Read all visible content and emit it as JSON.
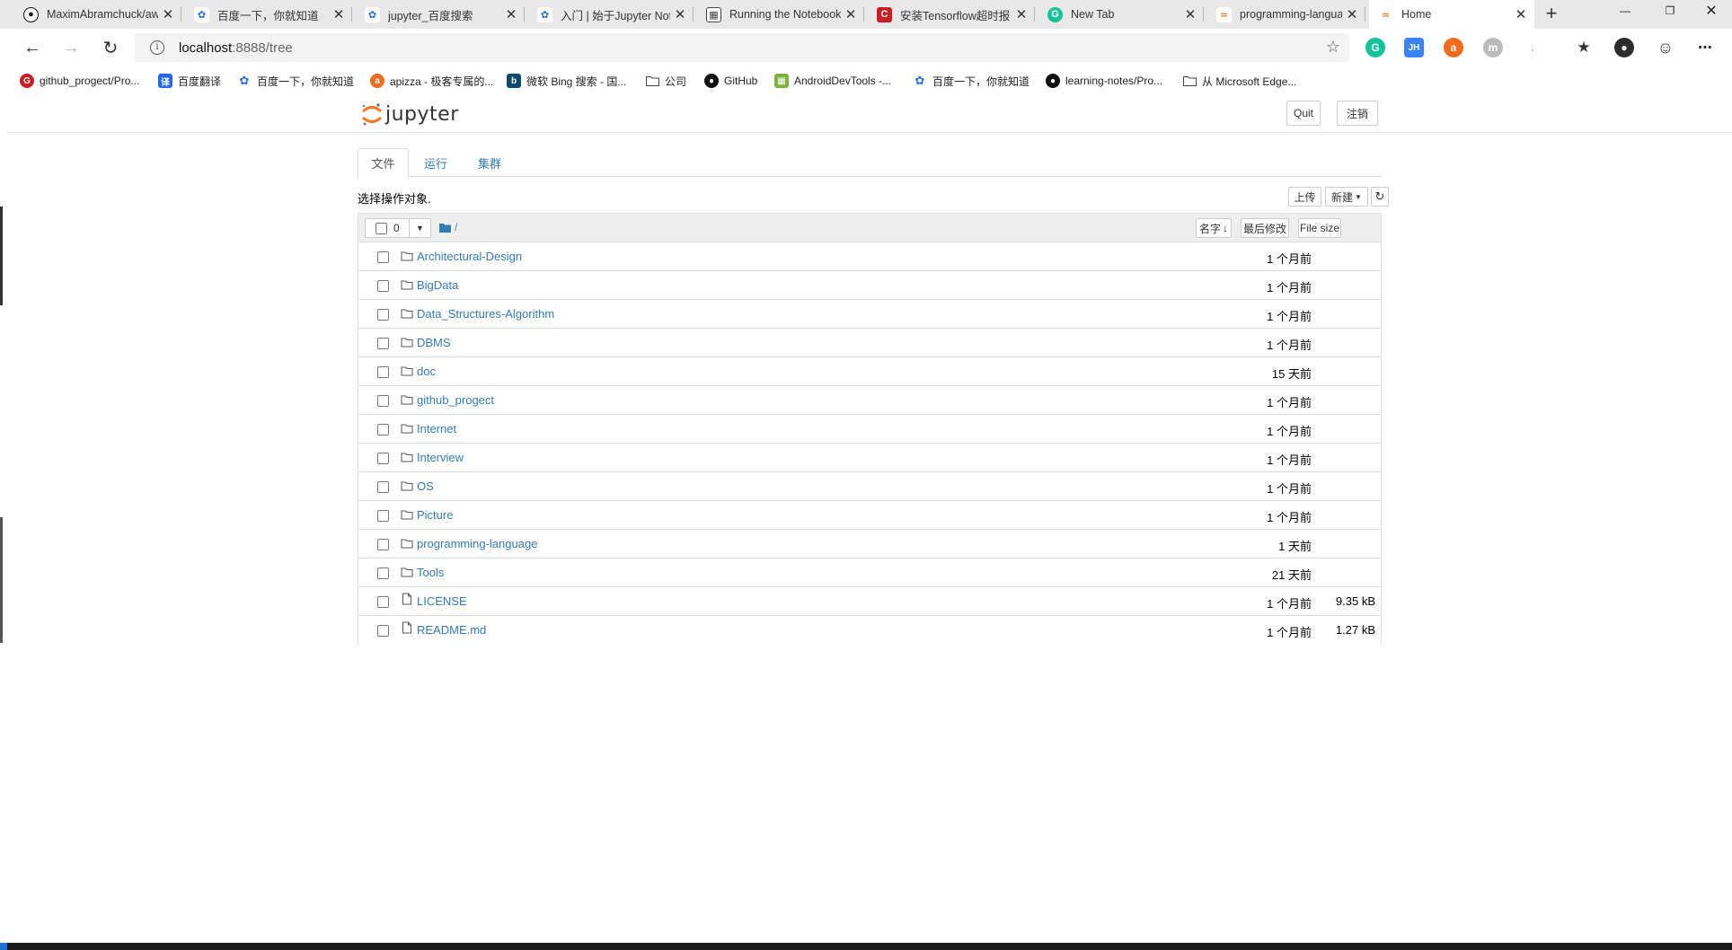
{
  "browser": {
    "tabs": [
      {
        "title": "MaximAbramchuck/aw",
        "icon": "github-icon",
        "active": false
      },
      {
        "title": "百度一下，你就知道",
        "icon": "baidu-icon",
        "active": false
      },
      {
        "title": "jupyter_百度搜索",
        "icon": "baidu-icon",
        "active": false
      },
      {
        "title": "入门 | 始于Jupyter Not",
        "icon": "baidu-icon",
        "active": false
      },
      {
        "title": "Running the Notebook",
        "icon": "book-icon",
        "active": false
      },
      {
        "title": "安装Tensorflow超时报",
        "icon": "csdn-icon",
        "active": false
      },
      {
        "title": "New Tab",
        "icon": "grammarly-icon",
        "active": false
      },
      {
        "title": "programming-languag",
        "icon": "jupyter-icon",
        "active": false
      },
      {
        "title": "Home",
        "icon": "jupyter-icon",
        "active": true
      }
    ],
    "url_host": "localhost",
    "url_path": ":8888/tree",
    "bookmarks": [
      {
        "label": "github_progect/Pro...",
        "icon": "gitee-icon",
        "color": "#c71d23"
      },
      {
        "label": "百度翻译",
        "icon": "translate-icon",
        "color": "#2468f2"
      },
      {
        "label": "百度一下，你就知道",
        "icon": "baidu-icon",
        "color": "#2468f2"
      },
      {
        "label": "apizza - 极客专属的...",
        "icon": "apizza-icon",
        "color": "#f26b1d"
      },
      {
        "label": "微软 Bing 搜索 - 国...",
        "icon": "bing-icon",
        "color": "#0c4a6e"
      },
      {
        "label": "公司",
        "icon": "folder-icon",
        "color": ""
      },
      {
        "label": "GitHub",
        "icon": "github-icon",
        "color": "#111"
      },
      {
        "label": "AndroidDevTools -...",
        "icon": "android-icon",
        "color": "#7cb342"
      },
      {
        "label": "百度一下，你就知道",
        "icon": "baidu-icon",
        "color": "#2468f2"
      },
      {
        "label": "learning-notes/Pro...",
        "icon": "github-icon",
        "color": "#111"
      },
      {
        "label": "从 Microsoft Edge...",
        "icon": "folder-icon",
        "color": ""
      }
    ]
  },
  "jupyter": {
    "logo_text": "jupyter",
    "quit_label": "Quit",
    "logout_label": "注销",
    "tabs": [
      "文件",
      "运行",
      "集群"
    ],
    "select_prompt": "选择操作对象.",
    "upload_label": "上传",
    "new_label": "新建",
    "selected_count": "0",
    "breadcrumb": "/",
    "col_name": "名字",
    "col_modified": "最后修改",
    "col_size": "File size",
    "items": [
      {
        "name": "Architectural-Design",
        "type": "folder",
        "modified": "1 个月前",
        "size": ""
      },
      {
        "name": "BigData",
        "type": "folder",
        "modified": "1 个月前",
        "size": ""
      },
      {
        "name": "Data_Structures-Algorithm",
        "type": "folder",
        "modified": "1 个月前",
        "size": ""
      },
      {
        "name": "DBMS",
        "type": "folder",
        "modified": "1 个月前",
        "size": ""
      },
      {
        "name": "doc",
        "type": "folder",
        "modified": "15 天前",
        "size": ""
      },
      {
        "name": "github_progect",
        "type": "folder",
        "modified": "1 个月前",
        "size": ""
      },
      {
        "name": "Internet",
        "type": "folder",
        "modified": "1 个月前",
        "size": ""
      },
      {
        "name": "Interview",
        "type": "folder",
        "modified": "1 个月前",
        "size": ""
      },
      {
        "name": "OS",
        "type": "folder",
        "modified": "1 个月前",
        "size": ""
      },
      {
        "name": "Picture",
        "type": "folder",
        "modified": "1 个月前",
        "size": ""
      },
      {
        "name": "programming-language",
        "type": "folder",
        "modified": "1 天前",
        "size": ""
      },
      {
        "name": "Tools",
        "type": "folder",
        "modified": "21 天前",
        "size": ""
      },
      {
        "name": "LICENSE",
        "type": "file",
        "modified": "1 个月前",
        "size": "9.35 kB"
      },
      {
        "name": "README.md",
        "type": "file",
        "modified": "1 个月前",
        "size": "1.27 kB"
      }
    ]
  },
  "colors": {
    "link": "#337ab7",
    "jupyter_orange": "#f37726"
  }
}
